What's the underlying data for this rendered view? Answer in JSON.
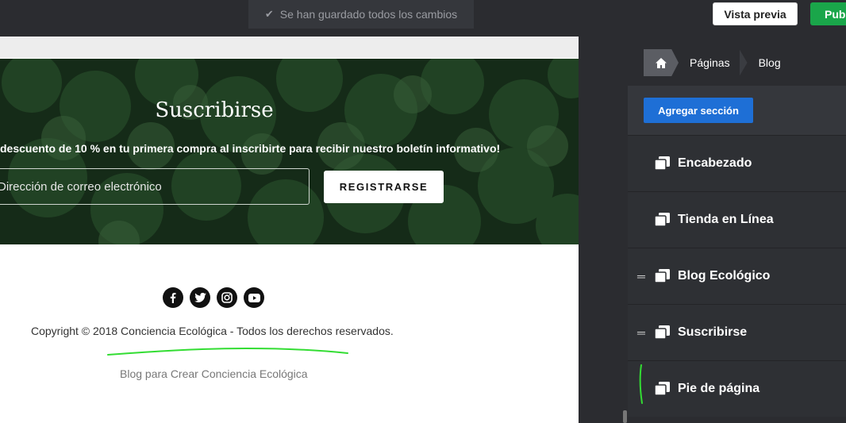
{
  "topbar": {
    "save_status": "Se han guardado todos los cambios",
    "preview_label": "Vista previa",
    "publish_label": "Publ"
  },
  "preview": {
    "subscribe": {
      "title": "Suscribirse",
      "subtitle": "descuento de 10 % en tu primera compra al inscribirte para recibir nuestro boletín informativo!",
      "email_placeholder": "Dirección de correo electrónico",
      "register_label": "REGISTRARSE"
    },
    "footer": {
      "social_icons": [
        "facebook-icon",
        "twitter-icon",
        "instagram-icon",
        "youtube-icon"
      ],
      "copyright": "Copyright © 2018 Conciencia Ecológica - Todos los derechos reservados.",
      "tagline": "Blog para Crear Conciencia Ecológica"
    }
  },
  "sidebar": {
    "breadcrumb": [
      "Páginas",
      "Blog"
    ],
    "add_section_label": "Agregar sección",
    "sections": [
      {
        "label": "Encabezado",
        "draggable": false
      },
      {
        "label": "Tienda en Línea",
        "draggable": false
      },
      {
        "label": "Blog Ecológico",
        "draggable": true
      },
      {
        "label": "Suscribirse",
        "draggable": true
      },
      {
        "label": "Pie de página",
        "draggable": false
      }
    ]
  },
  "colors": {
    "accent_blue": "#1e6fd6",
    "publish_green": "#1aa64a",
    "annotation_green": "#33dd33"
  }
}
